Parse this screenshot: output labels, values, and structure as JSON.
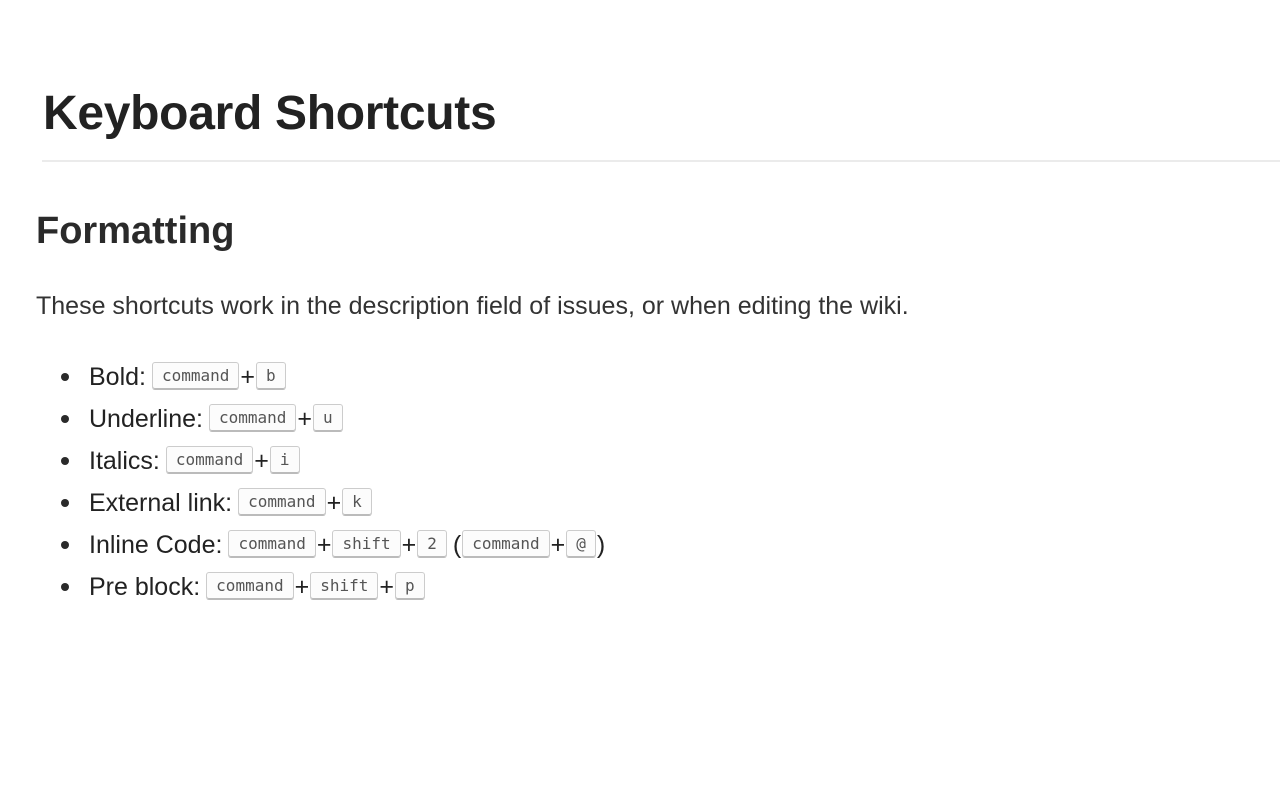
{
  "page": {
    "title": "Keyboard Shortcuts"
  },
  "section": {
    "heading": "Formatting",
    "intro": "These shortcuts work in the description field of issues, or when editing the wiki."
  },
  "shortcuts": [
    {
      "label": "Bold:",
      "keys": [
        "command",
        "b"
      ]
    },
    {
      "label": "Underline:",
      "keys": [
        "command",
        "u"
      ]
    },
    {
      "label": "Italics:",
      "keys": [
        "command",
        "i"
      ]
    },
    {
      "label": "External link:",
      "keys": [
        "command",
        "k"
      ]
    },
    {
      "label": "Inline Code:",
      "keys": [
        "command",
        "shift",
        "2"
      ],
      "alt_keys": [
        "command",
        "@"
      ]
    },
    {
      "label": "Pre block:",
      "keys": [
        "command",
        "shift",
        "p"
      ]
    }
  ],
  "symbols": {
    "plus": "+",
    "paren_open": "(",
    "paren_close": ")"
  }
}
